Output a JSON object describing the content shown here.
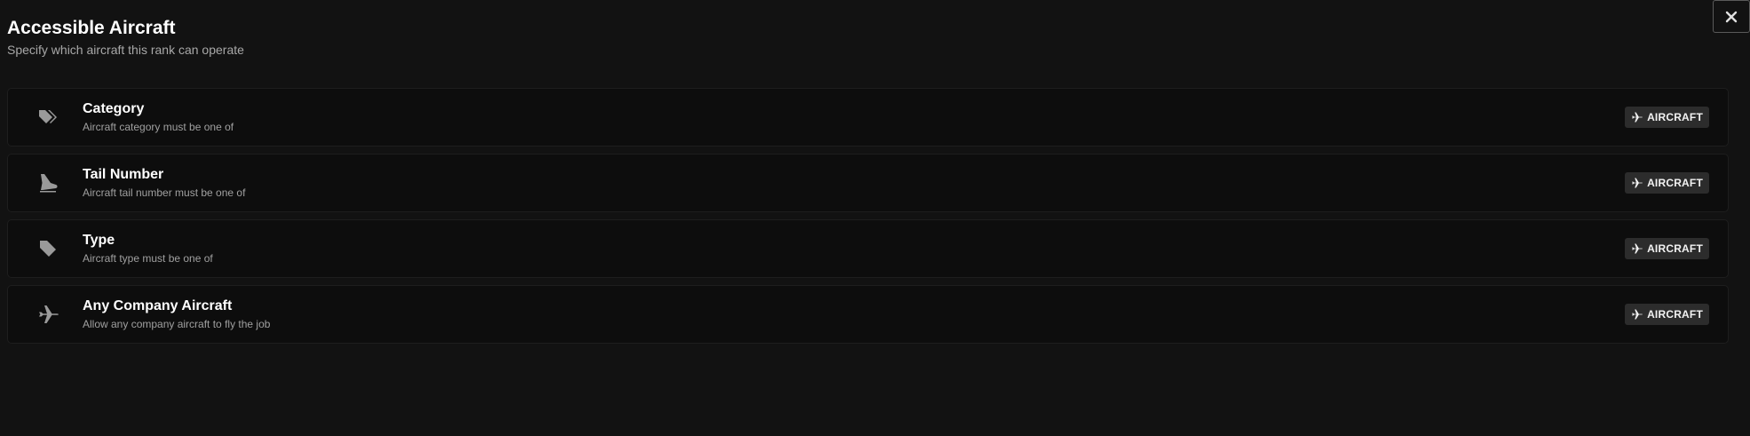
{
  "header": {
    "title": "Accessible Aircraft",
    "subtitle": "Specify which aircraft this rank can operate"
  },
  "close": {
    "icon": "close-icon"
  },
  "options": [
    {
      "title": "Category",
      "description": "Aircraft category must be one of",
      "icon": "tags-icon",
      "badge": "AIRCRAFT"
    },
    {
      "title": "Tail Number",
      "description": "Aircraft tail number must be one of",
      "icon": "plane-tail-icon",
      "badge": "AIRCRAFT"
    },
    {
      "title": "Type",
      "description": "Aircraft type must be one of",
      "icon": "tag-icon",
      "badge": "AIRCRAFT"
    },
    {
      "title": "Any Company Aircraft",
      "description": "Allow any company aircraft to fly the job",
      "icon": "plane-icon",
      "badge": "AIRCRAFT"
    }
  ],
  "colors": {
    "background": "#121212",
    "row_background": "#0d0d0d",
    "badge_background": "#2c2c2c",
    "icon": "#9a9a9a"
  }
}
